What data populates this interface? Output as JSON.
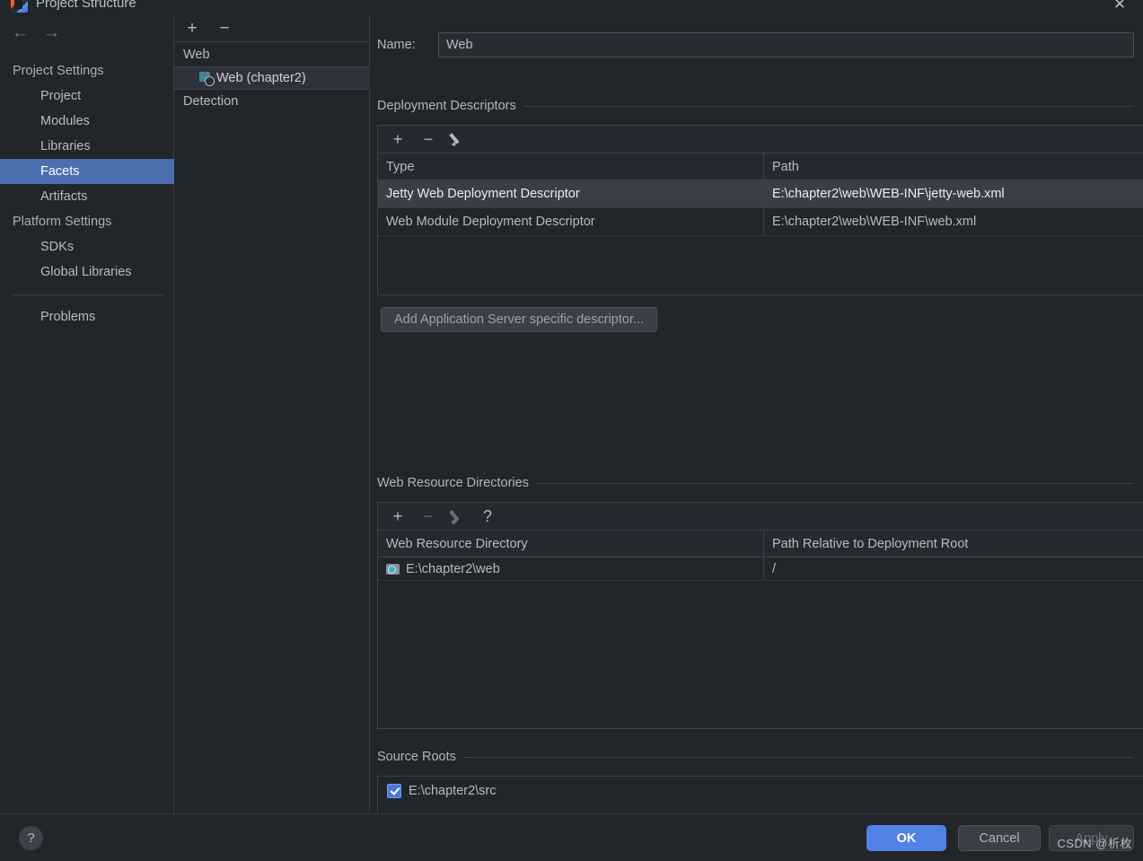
{
  "window": {
    "title": "Project Structure",
    "icon": "intellij-logo-icon",
    "close_label": "✕"
  },
  "nav": {
    "back_label": "←",
    "forward_label": "→",
    "groups": [
      {
        "label": "Project Settings",
        "items": [
          {
            "label": "Project",
            "selected": false
          },
          {
            "label": "Modules",
            "selected": false
          },
          {
            "label": "Libraries",
            "selected": false
          },
          {
            "label": "Facets",
            "selected": true
          },
          {
            "label": "Artifacts",
            "selected": false
          }
        ]
      },
      {
        "label": "Platform Settings",
        "items": [
          {
            "label": "SDKs",
            "selected": false
          },
          {
            "label": "Global Libraries",
            "selected": false
          }
        ]
      }
    ],
    "extra_item": {
      "label": "Problems",
      "selected": false
    }
  },
  "tree": {
    "toolbar": {
      "add_label": "+",
      "remove_label": "−"
    },
    "root_label": "Web",
    "child_label": "Web (chapter2)",
    "detection_label": "Detection"
  },
  "facet": {
    "name_label": "Name:",
    "name_value": "Web",
    "deployment_descriptors": {
      "title": "Deployment Descriptors",
      "toolbar": {
        "add_label": "+",
        "remove_label": "−",
        "edit_label": "edit-pencil"
      },
      "columns": [
        "Type",
        "Path"
      ],
      "rows": [
        {
          "type": "Jetty Web Deployment Descriptor",
          "path": "E:\\chapter2\\web\\WEB-INF\\jetty-web.xml",
          "selected": true
        },
        {
          "type": "Web Module Deployment Descriptor",
          "path": "E:\\chapter2\\web\\WEB-INF\\web.xml",
          "selected": false
        }
      ],
      "add_app_server_button": "Add Application Server specific descriptor..."
    },
    "web_resource_directories": {
      "title": "Web Resource Directories",
      "toolbar": {
        "add_label": "+",
        "remove_label": "−",
        "edit_label": "edit-pencil",
        "help_label": "?"
      },
      "columns": [
        "Web Resource Directory",
        "Path Relative to Deployment Root"
      ],
      "rows": [
        {
          "directory": "E:\\chapter2\\web",
          "relative_path": "/"
        }
      ]
    },
    "source_roots": {
      "title": "Source Roots",
      "rows": [
        {
          "path": "E:\\chapter2\\src",
          "checked": true
        }
      ]
    }
  },
  "footer": {
    "help_label": "?",
    "ok_label": "OK",
    "cancel_label": "Cancel",
    "apply_label": "Apply",
    "watermark": "CSDN @析枚"
  },
  "colors": {
    "accent": "#4b6eaf",
    "primary_button": "#5281e8",
    "background": "#22252a",
    "border": "#3d414a",
    "text": "#b6bbc4"
  }
}
